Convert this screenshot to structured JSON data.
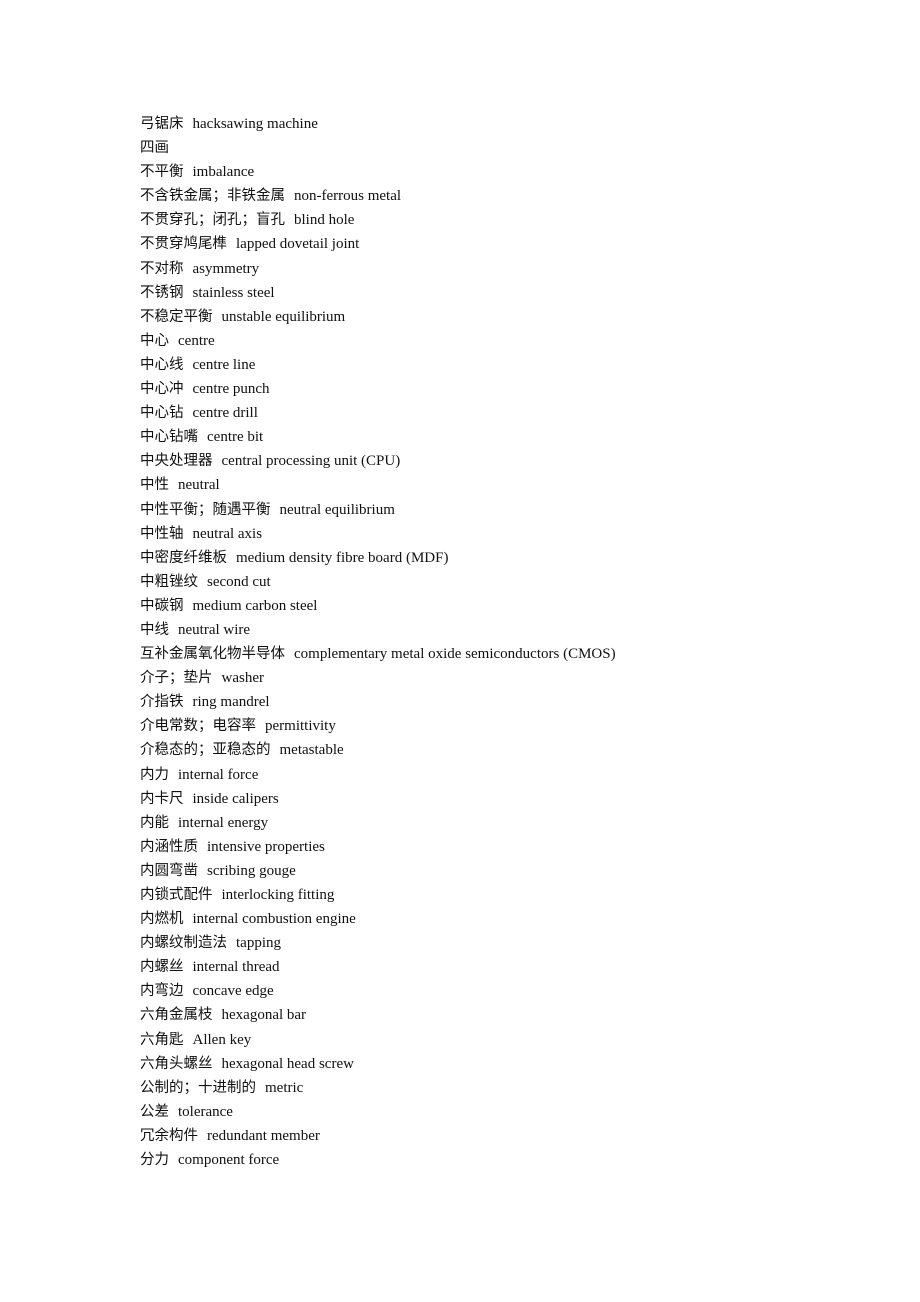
{
  "entries": [
    {
      "zh": "弓锯床",
      "en": "hacksawing machine"
    },
    {
      "zh": "四画",
      "en": ""
    },
    {
      "zh": "不平衡",
      "en": "imbalance"
    },
    {
      "zh": "不含铁金属；非铁金属",
      "en": "non-ferrous metal"
    },
    {
      "zh": "不贯穿孔；闭孔；盲孔",
      "en": "blind hole"
    },
    {
      "zh": "不贯穿鸠尾榫",
      "en": "lapped dovetail joint"
    },
    {
      "zh": "不对称",
      "en": "asymmetry"
    },
    {
      "zh": "不锈钢",
      "en": "stainless steel"
    },
    {
      "zh": "不稳定平衡",
      "en": "unstable equilibrium"
    },
    {
      "zh": "中心",
      "en": "centre"
    },
    {
      "zh": "中心线",
      "en": "centre line"
    },
    {
      "zh": "中心冲",
      "en": "centre punch"
    },
    {
      "zh": "中心钻",
      "en": "centre drill"
    },
    {
      "zh": "中心钻嘴",
      "en": "centre bit"
    },
    {
      "zh": "中央处理器",
      "en": "central processing unit (CPU)"
    },
    {
      "zh": "中性",
      "en": "neutral"
    },
    {
      "zh": "中性平衡；随遇平衡",
      "en": "neutral equilibrium"
    },
    {
      "zh": "中性轴",
      "en": "neutral axis"
    },
    {
      "zh": "中密度纤维板",
      "en": "medium density fibre board (MDF)"
    },
    {
      "zh": "中粗锉纹",
      "en": "second cut"
    },
    {
      "zh": "中碳钢",
      "en": "medium carbon steel"
    },
    {
      "zh": "中线",
      "en": "neutral wire"
    },
    {
      "zh": "互补金属氧化物半导体",
      "en": "complementary metal oxide semiconductors (CMOS)"
    },
    {
      "zh": "介子；垫片",
      "en": "washer"
    },
    {
      "zh": "介指铁",
      "en": "ring mandrel"
    },
    {
      "zh": "介电常数；电容率",
      "en": "permittivity"
    },
    {
      "zh": "介稳态的；亚稳态的",
      "en": "metastable"
    },
    {
      "zh": "内力",
      "en": "internal force"
    },
    {
      "zh": "内卡尺",
      "en": "inside calipers"
    },
    {
      "zh": "内能",
      "en": "internal energy"
    },
    {
      "zh": "内涵性质",
      "en": "intensive properties"
    },
    {
      "zh": "内圆弯凿",
      "en": "scribing gouge"
    },
    {
      "zh": "内锁式配件",
      "en": "interlocking fitting"
    },
    {
      "zh": "内燃机",
      "en": "internal combustion engine"
    },
    {
      "zh": "内螺纹制造法",
      "en": "tapping"
    },
    {
      "zh": "内螺丝",
      "en": "internal thread"
    },
    {
      "zh": "内弯边",
      "en": "concave edge"
    },
    {
      "zh": "六角金属枝",
      "en": "hexagonal bar"
    },
    {
      "zh": "六角匙",
      "en": "Allen key"
    },
    {
      "zh": "六角头螺丝",
      "en": "hexagonal head screw"
    },
    {
      "zh": "公制的；十进制的",
      "en": "metric"
    },
    {
      "zh": "公差",
      "en": "tolerance"
    },
    {
      "zh": "冗余构件",
      "en": "redundant member"
    },
    {
      "zh": "分力",
      "en": "component force"
    }
  ]
}
